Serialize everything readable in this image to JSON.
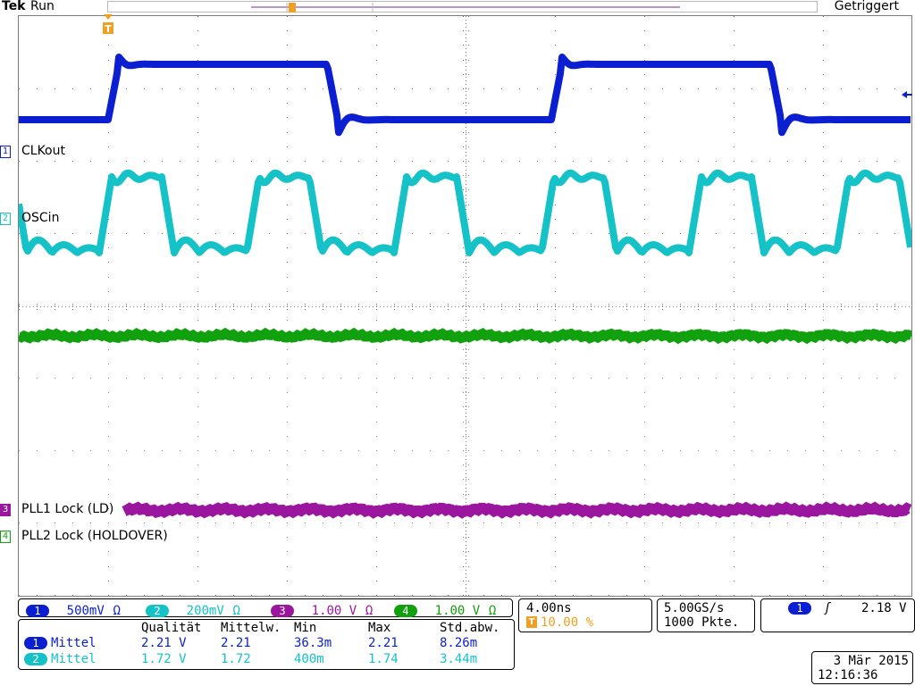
{
  "header": {
    "brand": "Tek",
    "state": "Run",
    "trigger_status": "Getriggert"
  },
  "colors": {
    "ch1": "#0b1fd0",
    "ch2": "#14c2c8",
    "ch3": "#9b169e",
    "ch4": "#12a10e",
    "trigger": "#f0a020"
  },
  "trigger_marker": "T",
  "channels": [
    {
      "num": "1",
      "label": "CLKout",
      "scale": "500mV",
      "coupling": "Ω"
    },
    {
      "num": "2",
      "label": "OSCin",
      "scale": "200mV",
      "coupling": "Ω"
    },
    {
      "num": "3",
      "label": "PLL1 Lock (LD)",
      "scale": "1.00 V",
      "coupling": "Ω"
    },
    {
      "num": "4",
      "label": "PLL2 Lock (HOLDOVER)",
      "scale": "1.00 V",
      "coupling": "Ω"
    }
  ],
  "timebase": {
    "value": "4.00ns",
    "trig_pos": "10.00 %"
  },
  "sampling": {
    "rate": "5.00GS/s",
    "points": "1000 Pkte."
  },
  "trigger": {
    "source": "1",
    "slope": "ʃ",
    "level": "2.18 V"
  },
  "measurements": {
    "headers": [
      "Qualität",
      "Mittelw.",
      "Min",
      "Max",
      "Std.abw."
    ],
    "rows": [
      {
        "ch": "1",
        "name": "Mittel",
        "values": [
          "2.21 V",
          "2.21",
          "36.3m",
          "2.21",
          "8.26m"
        ]
      },
      {
        "ch": "2",
        "name": "Mittel",
        "values": [
          "1.72 V",
          "1.72",
          "400m",
          "1.74",
          "3.44m"
        ]
      }
    ]
  },
  "datetime": {
    "date": "3 Mär  2015",
    "time": "12:16:36"
  }
}
